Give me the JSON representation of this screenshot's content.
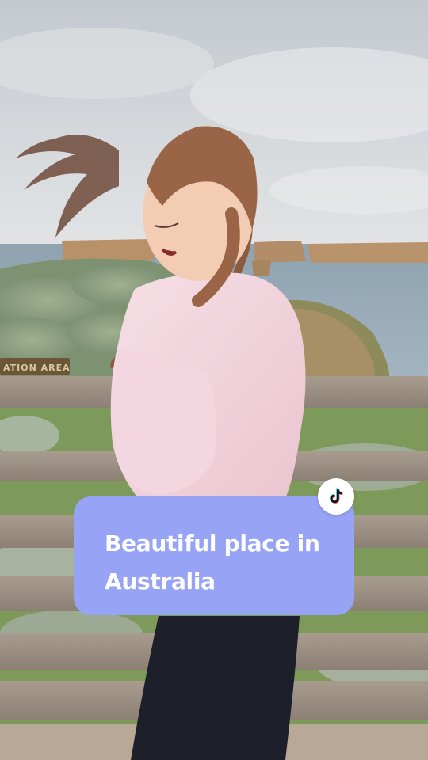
{
  "video": {
    "scene_description_icon": "video-frame",
    "sign_text": "ATION AREA"
  },
  "caption": {
    "text": "Beautiful place in Australia",
    "background_color": "#97a3f5",
    "text_color": "#ffffff"
  },
  "badge": {
    "icon": "tiktok-logo-icon"
  }
}
